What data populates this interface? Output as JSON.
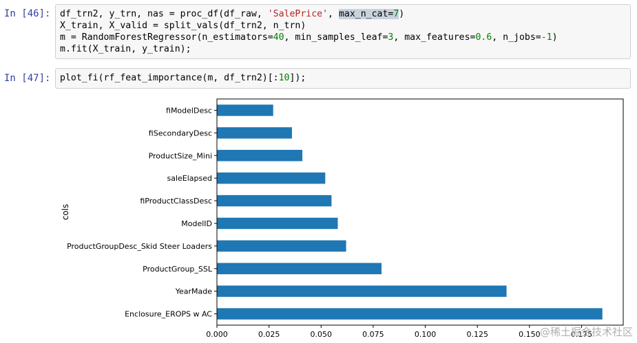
{
  "cells": [
    {
      "prompt": "In [46]:",
      "lines": [
        [
          {
            "t": "df_trn2, y_trn, nas = proc_df(df_raw, ",
            "c": ""
          },
          {
            "t": "'SalePrice'",
            "c": "str"
          },
          {
            "t": ", ",
            "c": ""
          },
          {
            "t": "max_n_cat=",
            "c": "sel"
          },
          {
            "t": "7",
            "c": "sel num"
          },
          {
            "t": ")",
            "c": ""
          }
        ],
        [
          {
            "t": "X_train, X_valid = split_vals(df_trn2, n_trn)",
            "c": ""
          }
        ],
        [
          {
            "t": "m = RandomForestRegressor(n_estimators=",
            "c": ""
          },
          {
            "t": "40",
            "c": "num"
          },
          {
            "t": ", min_samples_leaf=",
            "c": ""
          },
          {
            "t": "3",
            "c": "num"
          },
          {
            "t": ", max_features=",
            "c": ""
          },
          {
            "t": "0.6",
            "c": "num"
          },
          {
            "t": ", n_jobs=",
            "c": ""
          },
          {
            "t": "-1",
            "c": "num"
          },
          {
            "t": ")",
            "c": ""
          }
        ],
        [
          {
            "t": "m.fit(X_train, y_train);",
            "c": ""
          }
        ]
      ]
    },
    {
      "prompt": "In [47]:",
      "lines": [
        [
          {
            "t": "plot_fi(rf_feat_importance(m, df_trn2)[:",
            "c": ""
          },
          {
            "t": "10",
            "c": "num"
          },
          {
            "t": "]);",
            "c": ""
          }
        ]
      ]
    }
  ],
  "chart_data": {
    "type": "bar",
    "orientation": "horizontal",
    "categories": [
      "Enclosure_EROPS w AC",
      "YearMade",
      "ProductGroup_SSL",
      "ProductGroupDesc_Skid Steer Loaders",
      "ModelID",
      "fiProductClassDesc",
      "saleElapsed",
      "ProductSize_Mini",
      "fiSecondaryDesc",
      "fiModelDesc"
    ],
    "values": [
      0.185,
      0.139,
      0.079,
      0.062,
      0.058,
      0.055,
      0.052,
      0.041,
      0.036,
      0.027
    ],
    "ylabel": "cols",
    "xlabel": "",
    "xlim": [
      0,
      0.195
    ],
    "xticks": [
      "0.000",
      "0.025",
      "0.050",
      "0.075",
      "0.100",
      "0.125",
      "0.150",
      "0.175"
    ],
    "bar_color": "#1f77b4",
    "grid": false
  },
  "watermark": "@稀土掘金技术社区"
}
